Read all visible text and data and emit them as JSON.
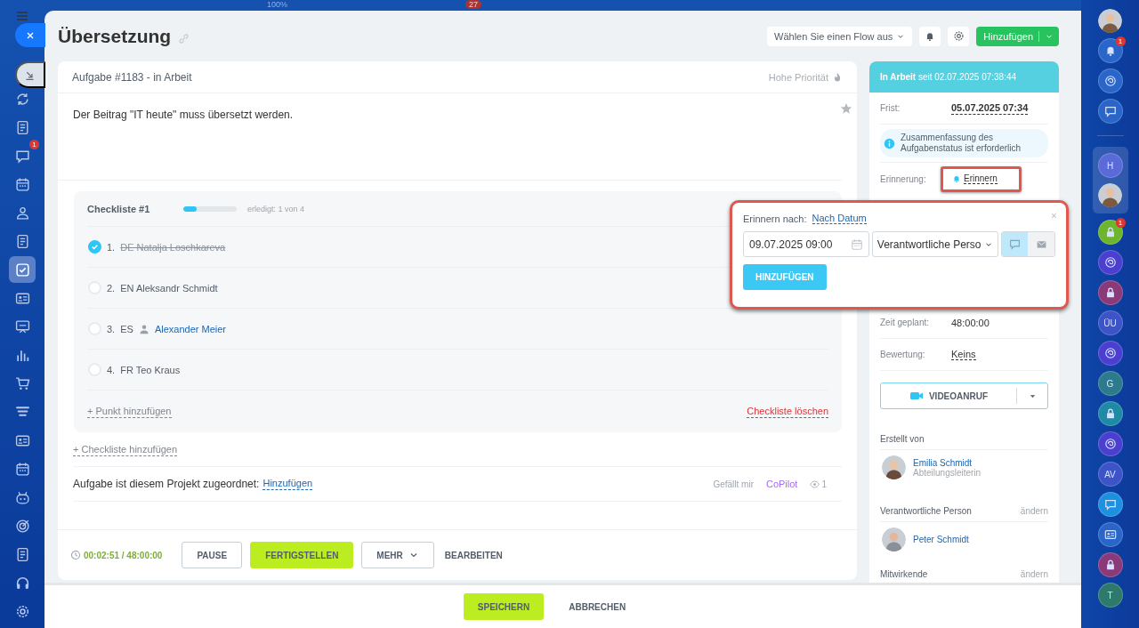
{
  "background": {
    "zoom_label": "100%",
    "badge": "27"
  },
  "left_rail": {
    "items": [
      {
        "kind": "loop",
        "selected": false
      },
      {
        "kind": "doc",
        "selected": false
      },
      {
        "kind": "chat",
        "badge": "1",
        "selected": false
      },
      {
        "kind": "calendar",
        "selected": false
      },
      {
        "kind": "people",
        "selected": false
      },
      {
        "kind": "doc",
        "selected": false
      },
      {
        "kind": "check",
        "selected": true
      },
      {
        "kind": "card",
        "selected": false
      },
      {
        "kind": "board",
        "selected": false
      },
      {
        "kind": "chart",
        "selected": false
      },
      {
        "kind": "cart",
        "selected": false
      },
      {
        "kind": "funnel",
        "selected": false
      },
      {
        "kind": "card",
        "selected": false
      },
      {
        "kind": "calendar",
        "selected": false
      },
      {
        "kind": "robot",
        "selected": false
      },
      {
        "kind": "target",
        "selected": false
      },
      {
        "kind": "doc",
        "selected": false
      },
      {
        "kind": "headset",
        "selected": false
      },
      {
        "kind": "gear",
        "selected": false
      }
    ]
  },
  "header": {
    "title": "Übersetzung",
    "flow_select": "Wählen Sie einen Flow aus",
    "add_button": "Hinzufügen"
  },
  "task": {
    "heading": "Aufgabe #1183 - in Arbeit",
    "priority": "Hohe Priorität",
    "description": "Der Beitrag \"IT heute\" muss übersetzt werden.",
    "checklist": {
      "title": "Checkliste #1",
      "level": 0.25,
      "progress": "erledigt: 1 von 4",
      "items": [
        {
          "number": "1.",
          "text": "DE Natalja Loschkareva",
          "checked": true
        },
        {
          "number": "2.",
          "text": "EN Aleksandr Schmidt",
          "checked": false
        },
        {
          "number": "3.",
          "text": "ES",
          "person": "Alexander Meier",
          "checked": false
        },
        {
          "number": "4.",
          "text": "FR Teo Kraus",
          "checked": false
        }
      ],
      "add_item": "+ Punkt hinzufügen",
      "delete": "Checkliste löschen"
    },
    "add_checklist": "+ Checkliste hinzufügen",
    "project_label": "Aufgabe ist diesem Projekt zugeordnet:",
    "project_link": "Hinzufügen",
    "like": "Gefällt mir",
    "copilot": "CoPilot",
    "views": "1"
  },
  "footer": {
    "timer": "00:02:51 / 48:00:00",
    "buttons": [
      {
        "kind": "outline",
        "label": "PAUSE"
      },
      {
        "kind": "primary",
        "label": "FERTIGSTELLEN"
      },
      {
        "kind": "menu",
        "label": "MEHR"
      },
      {
        "kind": "text",
        "label": "BEARBEITEN"
      }
    ]
  },
  "sidebar": {
    "status": "**In Arbeit** seit 02.07.2025 07:38:44",
    "deadline_label": "Frist:",
    "deadline": "05.07.2025 07:34",
    "note": "Zusammenfassung des Aufgabenstatus ist erforderlich",
    "reminder_label": "Erinnerung:",
    "reminder_link": "Erinnern",
    "reminder_highlighted": true,
    "fields": [
      {
        "label": "Zeit geplant:",
        "value": "48:00:00",
        "kind": "plain"
      },
      {
        "label": "Bewertung:",
        "value": "Keins",
        "kind": "link"
      }
    ],
    "video_button": "VIDEOANRUF",
    "creator": {
      "heading": "Erstellt von",
      "name": "Emilia Schmidt",
      "role": "Abteilungsleiterin"
    },
    "responsible": {
      "heading": "Verantwortliche Person",
      "action": "ändern",
      "name": "Peter Schmidt"
    },
    "participants": {
      "heading": "Mitwirkende",
      "action": "ändern"
    }
  },
  "popup": {
    "label": "Erinnern nach:",
    "mode": "Nach Datum",
    "date": "09.07.2025 09:00",
    "recipient": "Verantwortliche Perso",
    "channels": [
      {
        "kind": "chat",
        "selected": true
      },
      {
        "kind": "mail",
        "selected": false
      }
    ],
    "button": "HINZUFÜGEN",
    "highlighted": true
  },
  "bottom_bar": {
    "buttons": [
      {
        "kind": "primary",
        "label": "SPEICHERN"
      },
      {
        "kind": "text",
        "label": "ABBRECHEN"
      }
    ]
  },
  "right_rail": {
    "items": [
      {
        "kind": "avatar"
      },
      {
        "kind": "bell",
        "badge": "1",
        "color": "#2a66c9"
      },
      {
        "kind": "swirl",
        "color": "#2a66c9"
      },
      {
        "kind": "chat",
        "color": "#2a66c9"
      },
      {
        "kind": "letter",
        "letter": "H",
        "color": "#5a6ad8",
        "group": true
      },
      {
        "kind": "avatar",
        "group": true
      },
      {
        "kind": "lock",
        "badge": "1",
        "color": "#6cb52d"
      },
      {
        "kind": "swirl",
        "color": "#4b3fd0"
      },
      {
        "kind": "lock",
        "color": "#8a3a78"
      },
      {
        "kind": "letter",
        "letter": "ÜU",
        "color": "#3c54c8"
      },
      {
        "kind": "swirl",
        "color": "#4b3fd0"
      },
      {
        "kind": "letter",
        "letter": "G",
        "color": "#2d7a8c"
      },
      {
        "kind": "lock",
        "color": "#1f8aa6"
      },
      {
        "kind": "swirl",
        "color": "#4b3fd0"
      },
      {
        "kind": "letter",
        "letter": "AV",
        "color": "#3c54c8"
      },
      {
        "kind": "chat",
        "color": "#1e90e0"
      },
      {
        "kind": "card",
        "color": "#2a66c9"
      },
      {
        "kind": "lock",
        "color": "#8a3a78"
      },
      {
        "kind": "letter",
        "letter": "T",
        "color": "#2d7a6c"
      }
    ]
  }
}
